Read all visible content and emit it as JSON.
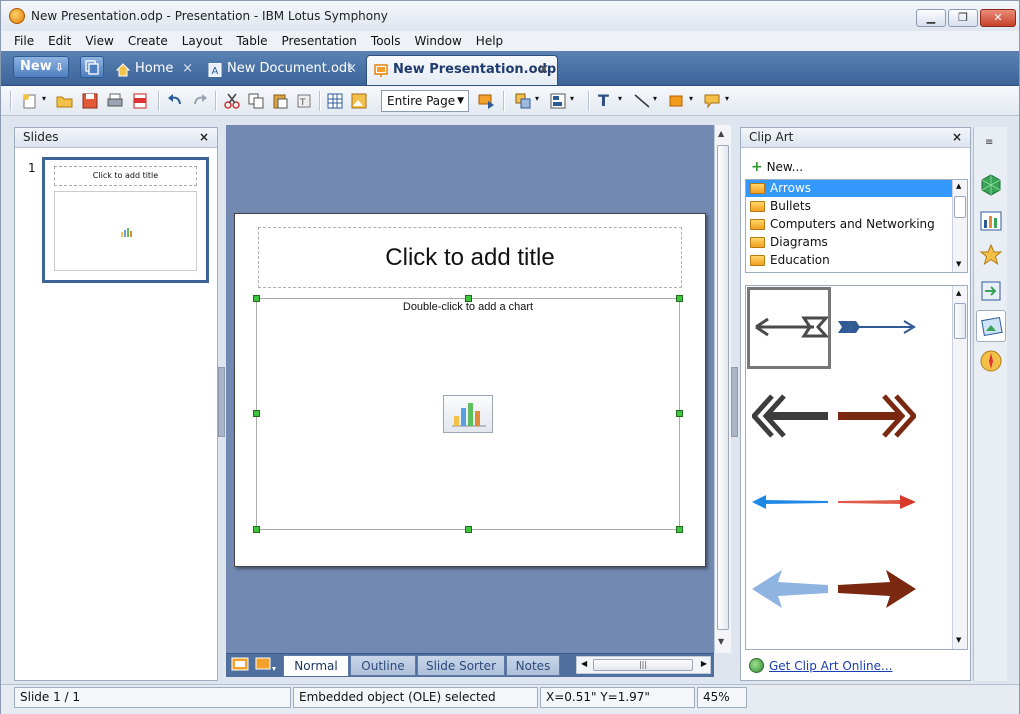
{
  "window": {
    "title": "New Presentation.odp - Presentation - IBM Lotus Symphony",
    "minimize": "▁",
    "restore": "❐",
    "close": "✕"
  },
  "menu": [
    "File",
    "Edit",
    "View",
    "Create",
    "Layout",
    "Table",
    "Presentation",
    "Tools",
    "Window",
    "Help"
  ],
  "tabs": {
    "new_label": "New",
    "items": [
      {
        "label": "Home",
        "close": "×"
      },
      {
        "label": "New Document.odt",
        "close": "×"
      },
      {
        "label": "New Presentation.odp",
        "close": "×"
      }
    ]
  },
  "toolbar": {
    "zoom": "Entire Page"
  },
  "slides_panel": {
    "title": "Slides",
    "close": "×",
    "slide_number": "1",
    "thumb_title": "Click to add title"
  },
  "slide": {
    "title_placeholder": "Click to add title",
    "chart_hint": "Double-click to add a chart"
  },
  "view_tabs": [
    "Normal",
    "Outline",
    "Slide Sorter",
    "Notes"
  ],
  "clip_art": {
    "title": "Clip Art",
    "close": "×",
    "new_label": "New...",
    "categories": [
      "Arrows",
      "Bullets",
      "Computers and Networking",
      "Diagrams",
      "Education"
    ],
    "selected": "Arrows",
    "online_link": "Get Clip Art Online..."
  },
  "status": {
    "slide": "Slide 1 / 1",
    "object": "Embedded object (OLE) selected",
    "coords": "X=0.51\" Y=1.97\"",
    "zoom": "45%"
  },
  "colors": {
    "accent": "#3d6499",
    "selection": "#3399ff",
    "canvas": "#7289b2",
    "handle": "#3ec43e"
  }
}
